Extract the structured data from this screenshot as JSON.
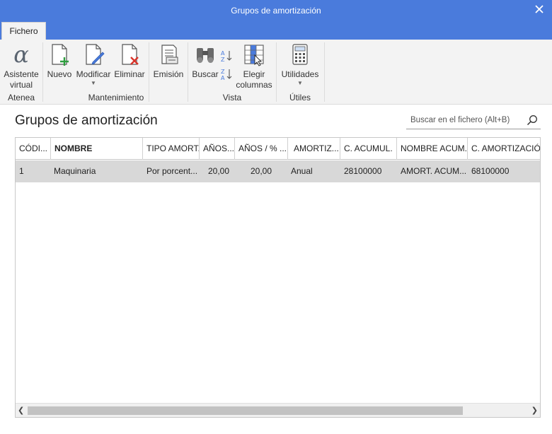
{
  "window": {
    "title": "Grupos de amortización"
  },
  "tabs": [
    {
      "label": "Fichero"
    }
  ],
  "ribbon": {
    "atenea": {
      "group_label": "Atenea",
      "asistente_line1": "Asistente",
      "asistente_line2": "virtual"
    },
    "mantenimiento": {
      "group_label": "Mantenimiento",
      "nuevo": "Nuevo",
      "modificar": "Modificar",
      "eliminar": "Eliminar",
      "emision": "Emisión"
    },
    "vista": {
      "group_label": "Vista",
      "buscar": "Buscar",
      "elegir_line1": "Elegir",
      "elegir_line2": "columnas"
    },
    "utiles": {
      "group_label": "Útiles",
      "utilidades": "Utilidades"
    }
  },
  "main": {
    "title": "Grupos de amortización",
    "search_placeholder": "Buscar en el fichero (Alt+B)"
  },
  "table": {
    "columns": [
      "CÓDI...",
      "NOMBRE",
      "TIPO AMORT.",
      "AÑOS...",
      "AÑOS / % ...",
      "AMORTIZ...",
      "C. ACUMUL.",
      "NOMBRE ACUM.",
      "C. AMORTIZACIÓN"
    ],
    "rows": [
      [
        "1",
        "Maquinaria",
        "Por porcent...",
        "20,00",
        "20,00",
        "Anual",
        "28100000",
        "AMORT. ACUM...",
        "68100000"
      ]
    ]
  },
  "colors": {
    "titlebar": "#4a7bdc",
    "ribbon": "#f3f3f3",
    "selected_row": "#d8d8d8"
  }
}
